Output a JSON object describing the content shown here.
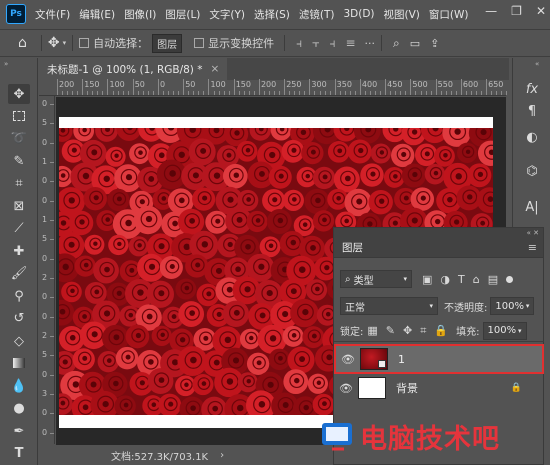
{
  "app": {
    "logo": "Ps"
  },
  "menu": [
    "文件(F)",
    "编辑(E)",
    "图像(I)",
    "图层(L)",
    "文字(Y)",
    "选择(S)",
    "滤镜(T)",
    "3D(D)",
    "视图(V)",
    "窗口(W)"
  ],
  "window_controls": {
    "minimize": "—",
    "restore": "❐",
    "close": "✕"
  },
  "options_bar": {
    "auto_select_label": "自动选择：",
    "auto_select_value": "图层",
    "show_transform_label": "显示变换控件",
    "more": "···"
  },
  "document": {
    "tab_title": "未标题-1 @ 100% (1, RGB/8) *",
    "close": "×"
  },
  "ruler": {
    "top_labels": [
      "200",
      "150",
      "100",
      "50",
      "0",
      "50",
      "100",
      "150",
      "200",
      "250",
      "300",
      "350",
      "400",
      "450",
      "500",
      "550",
      "600",
      "650"
    ],
    "left_labels": [
      "0",
      "5",
      "0",
      "1",
      "0",
      "0",
      "1",
      "5",
      "0",
      "2",
      "0",
      "0",
      "2",
      "5",
      "0",
      "3",
      "0",
      "0"
    ]
  },
  "status": {
    "doc_size": "文档:527.3K/703.1K",
    "arrow": "›"
  },
  "layers_panel": {
    "title": "图层",
    "filter_label": "类型",
    "blend_mode": "正常",
    "opacity_label": "不透明度:",
    "opacity_value": "100%",
    "lock_label": "锁定:",
    "fill_label": "填充:",
    "fill_value": "100%",
    "layers": [
      {
        "name": "1",
        "selected": true
      },
      {
        "name": "背景",
        "selected": false
      }
    ]
  },
  "watermark": {
    "text": "电脑技术吧"
  },
  "colors": {
    "accent": "#e5343c",
    "selection_outline": "#e03030",
    "rose": "#b3141c"
  }
}
